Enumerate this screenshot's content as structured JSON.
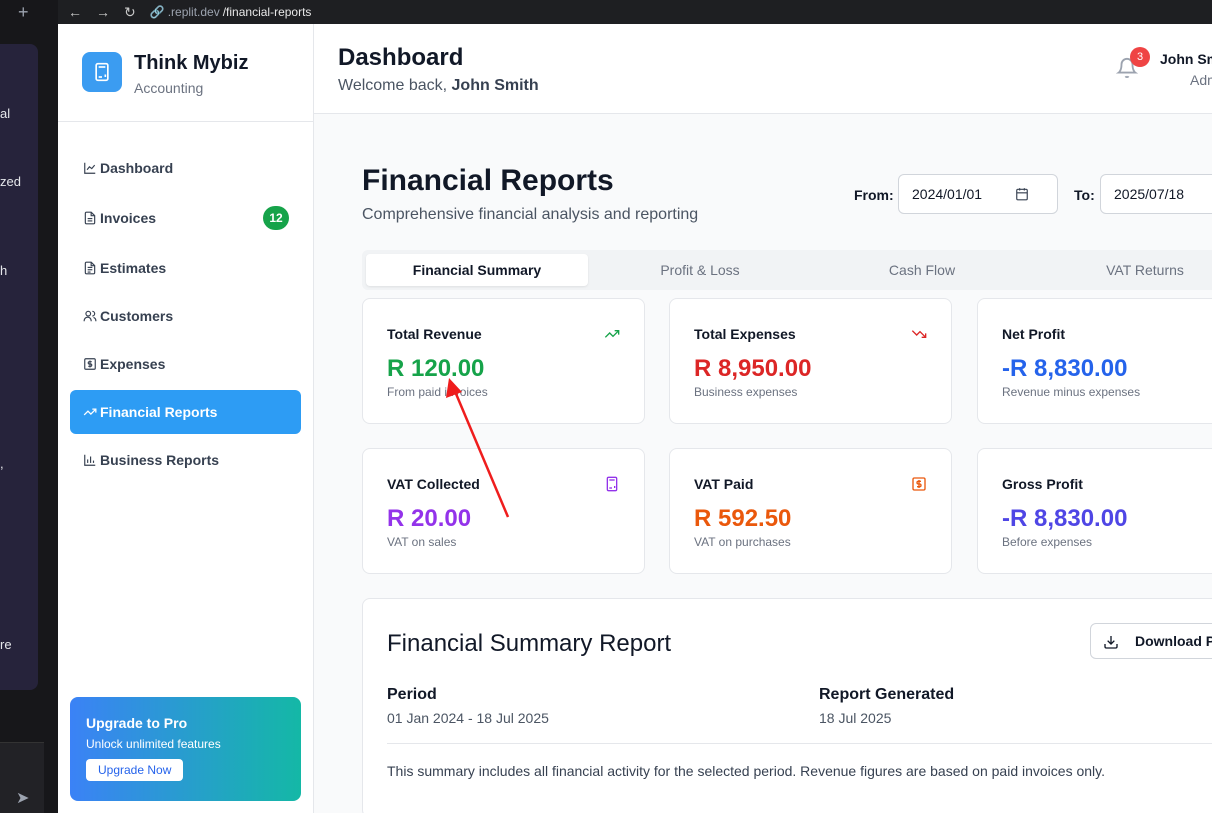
{
  "browser": {
    "url_prefix": ".replit.dev",
    "url_path": "/financial-reports"
  },
  "ide_strip": {
    "fragments": [
      "",
      "al",
      "zed",
      "h",
      ",",
      "re"
    ]
  },
  "brand": {
    "name": "Think Mybiz",
    "subtitle": "Accounting",
    "icon": "calculator-icon"
  },
  "sidebar": {
    "items": [
      {
        "label": "Dashboard",
        "icon": "line-chart-icon"
      },
      {
        "label": "Invoices",
        "icon": "file-icon",
        "badge": "12"
      },
      {
        "label": "Estimates",
        "icon": "file-text-icon"
      },
      {
        "label": "Customers",
        "icon": "users-icon"
      },
      {
        "label": "Expenses",
        "icon": "dollar-receipt-icon"
      },
      {
        "label": "Financial Reports",
        "icon": "trending-up-icon",
        "active": true
      },
      {
        "label": "Business Reports",
        "icon": "bar-chart-icon"
      }
    ],
    "upgrade": {
      "title": "Upgrade to Pro",
      "subtitle": "Unlock unlimited features",
      "button": "Upgrade Now"
    }
  },
  "header": {
    "title": "Dashboard",
    "welcome_prefix": "Welcome back,",
    "welcome_name": "John Smith",
    "notifications": "3",
    "user_name": "John Smith",
    "user_role": "Admin"
  },
  "main": {
    "title": "Financial Reports",
    "subtitle": "Comprehensive financial analysis and reporting",
    "from_label": "From:",
    "from_value": "2024/01/01",
    "to_label": "To:",
    "to_value": "2025/07/18",
    "tabs": [
      {
        "label": "Financial Summary",
        "active": true
      },
      {
        "label": "Profit & Loss"
      },
      {
        "label": "Cash Flow"
      },
      {
        "label": "VAT Returns"
      }
    ],
    "cards": [
      {
        "title": "Total Revenue",
        "value": "R 120.00",
        "sub": "From paid invoices",
        "color": "#16a34a",
        "icon": "trending-up-icon"
      },
      {
        "title": "Total Expenses",
        "value": "R 8,950.00",
        "sub": "Business expenses",
        "color": "#dc2626",
        "icon": "trending-down-icon"
      },
      {
        "title": "Net Profit",
        "value": "-R 8,830.00",
        "sub": "Revenue minus expenses",
        "color": "#2563eb",
        "icon": ""
      },
      {
        "title": "VAT Collected",
        "value": "R 20.00",
        "sub": "VAT on sales",
        "color": "#9333ea",
        "icon": "calculator-icon"
      },
      {
        "title": "VAT Paid",
        "value": "R 592.50",
        "sub": "VAT on purchases",
        "color": "#ea580c",
        "icon": "dollar-receipt-icon"
      },
      {
        "title": "Gross Profit",
        "value": "-R 8,830.00",
        "sub": "Before expenses",
        "color": "#4f46e5",
        "icon": ""
      }
    ],
    "report": {
      "title": "Financial Summary Report",
      "download": "Download PDF",
      "period_label": "Period",
      "period_value": "01 Jan 2024 - 18 Jul 2025",
      "generated_label": "Report Generated",
      "generated_value": "18 Jul 2025",
      "note": "This summary includes all financial activity for the selected period. Revenue figures are based on paid invoices only."
    }
  },
  "annotation": {
    "color": "#ef1d1d"
  }
}
